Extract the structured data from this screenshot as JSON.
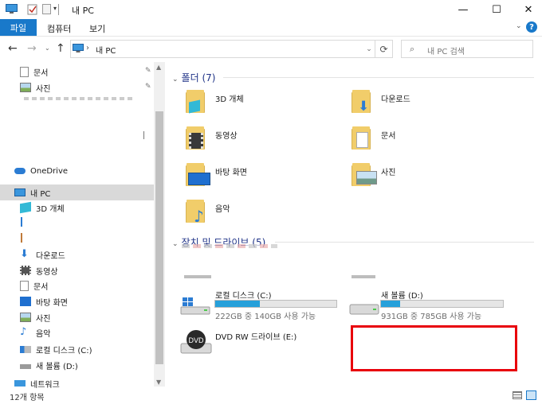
{
  "window": {
    "title": "내 PC"
  },
  "ribbon": {
    "tabs": [
      "파일",
      "컴퓨터",
      "보기"
    ]
  },
  "address": {
    "location": "내 PC",
    "search_placeholder": "내 PC 검색"
  },
  "nav": {
    "items": [
      {
        "label": "문서",
        "pinned": true
      },
      {
        "label": "사진",
        "pinned": true
      },
      {
        "label": "OneDrive"
      },
      {
        "label": "내 PC",
        "selected": true
      },
      {
        "label": "3D 개체"
      },
      {
        "label": "다운로드"
      },
      {
        "label": "동영상"
      },
      {
        "label": "문서"
      },
      {
        "label": "바탕 화면"
      },
      {
        "label": "사진"
      },
      {
        "label": "음악"
      },
      {
        "label": "로컬 디스크 (C:)"
      },
      {
        "label": "새 볼륨 (D:)"
      },
      {
        "label": "네트워크"
      }
    ]
  },
  "folders": {
    "header": "폴더 (7)",
    "items": [
      "3D 개체",
      "다운로드",
      "동영상",
      "문서",
      "바탕 화면",
      "사진",
      "음악"
    ]
  },
  "drives": {
    "header": "장치 및 드라이브 (5)",
    "items": [
      {
        "name": "로컬 디스크 (C:)",
        "info": "222GB 중 140GB 사용 가능",
        "used_fraction": 0.37
      },
      {
        "name": "새 볼륨 (D:)",
        "info": "931GB 중 785GB 사용 가능",
        "used_fraction": 0.16
      },
      {
        "name": "DVD RW 드라이브 (E:)"
      }
    ]
  },
  "status": {
    "count": "12개 항목"
  },
  "colors": {
    "accent": "#1979ca",
    "highlight_box": "#e8000b",
    "drive_fill": "#26a0da"
  }
}
